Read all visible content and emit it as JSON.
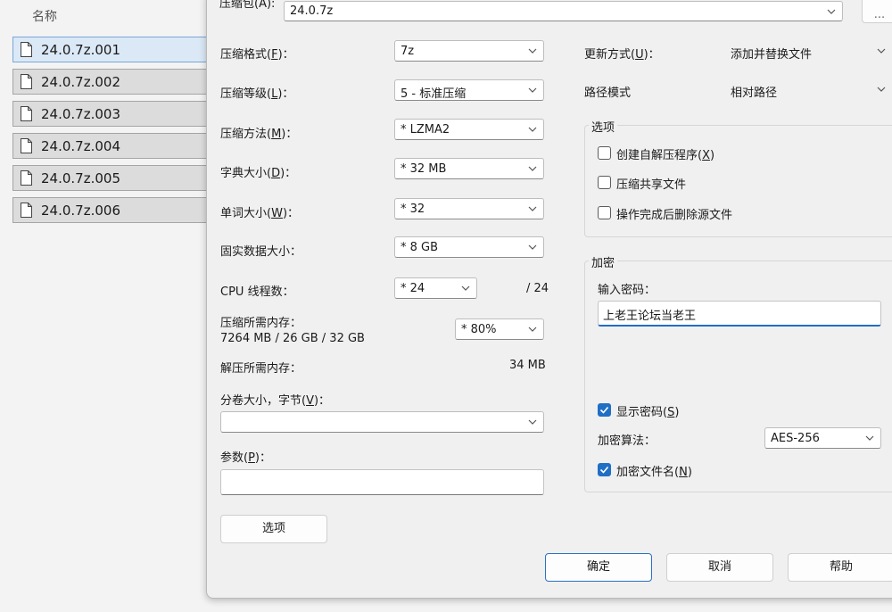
{
  "explorer": {
    "column_header": "名称",
    "files": [
      "24.0.7z.001",
      "24.0.7z.002",
      "24.0.7z.003",
      "24.0.7z.004",
      "24.0.7z.005",
      "24.0.7z.006"
    ]
  },
  "dialog": {
    "archive": {
      "label": "压缩包(A):",
      "value": "24.0.7z",
      "browse_label": "..."
    },
    "left": {
      "format": {
        "label": "压缩格式(",
        "key": "F",
        "tail": ")：",
        "value": "7z"
      },
      "level": {
        "label": "压缩等级(",
        "key": "L",
        "tail": ")：",
        "value": "5 - 标准压缩"
      },
      "method": {
        "label": "压缩方法(",
        "key": "M",
        "tail": ")：",
        "value": "* LZMA2"
      },
      "dict": {
        "label": "字典大小(",
        "key": "D",
        "tail": ")：",
        "value": "* 32 MB"
      },
      "word": {
        "label": "单词大小(",
        "key": "W",
        "tail": ")：",
        "value": "* 32"
      },
      "solid": {
        "label": "固实数据大小：",
        "value": "* 8 GB"
      },
      "threads": {
        "label": "CPU 线程数：",
        "value": "* 24",
        "max": "/ 24"
      },
      "mem_compress": {
        "label": "压缩所需内存：",
        "detail": "7264 MB / 26 GB / 32 GB",
        "value": "* 80%"
      },
      "mem_decompress": {
        "label": "解压所需内存：",
        "value": "34 MB"
      },
      "volume": {
        "label": "分卷大小，字节(",
        "key": "V",
        "tail": ")：",
        "value": ""
      },
      "params": {
        "label": "参数(",
        "key": "P",
        "tail": ")：",
        "value": ""
      },
      "options_button": "选项"
    },
    "right": {
      "update": {
        "label": "更新方式(",
        "key": "U",
        "tail": ")：",
        "value": "添加并替换文件"
      },
      "path_mode": {
        "label": "路径模式",
        "value": "相对路径"
      },
      "options_group": {
        "title": "选项",
        "sfx": {
          "label": "创建自解压程序(",
          "key": "X",
          "tail": ")",
          "checked": false
        },
        "shared": {
          "label": "压缩共享文件",
          "checked": false
        },
        "delete": {
          "label": "操作完成后删除源文件",
          "checked": false
        }
      },
      "encryption": {
        "title": "加密",
        "password_label": "输入密码：",
        "password": "上老王论坛当老王",
        "show_password": {
          "label": "显示密码(",
          "key": "S",
          "tail": ")",
          "checked": true
        },
        "method": {
          "label": "加密算法：",
          "value": "AES-256"
        },
        "encrypt_names": {
          "label": "加密文件名(",
          "key": "N",
          "tail": ")",
          "checked": true
        }
      }
    },
    "buttons": {
      "ok": "确定",
      "cancel": "取消",
      "help": "帮助"
    },
    "colors": {
      "accent": "#1f6fc5",
      "selection": "#dbe9f7"
    }
  }
}
